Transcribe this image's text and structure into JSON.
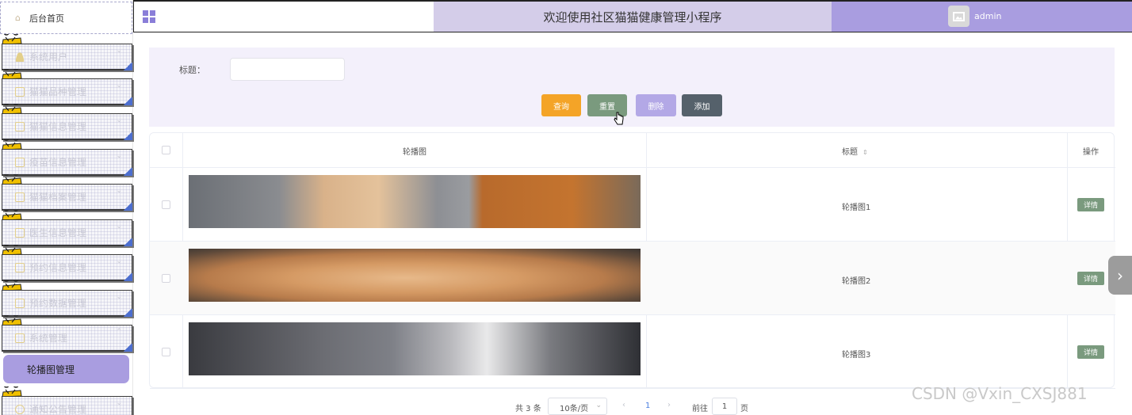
{
  "sidebar": {
    "home_label": "后台首页",
    "items": [
      {
        "label": "系统用户",
        "icon": "person-icon"
      },
      {
        "label": "猫猫品种管理",
        "icon": "folder-icon"
      },
      {
        "label": "猫猫信息管理",
        "icon": "folder-icon"
      },
      {
        "label": "疫苗信息管理",
        "icon": "folder-icon"
      },
      {
        "label": "猫猫档案管理",
        "icon": "folder-icon"
      },
      {
        "label": "医生信息管理",
        "icon": "folder-icon"
      },
      {
        "label": "预约信息管理",
        "icon": "folder-icon"
      },
      {
        "label": "预约数据管理",
        "icon": "folder-icon"
      },
      {
        "label": "系统管理",
        "icon": "image-icon"
      }
    ],
    "active_label": "轮播图管理",
    "after_active": {
      "label": "通知公告管理",
      "icon": "info-icon"
    }
  },
  "header": {
    "title": "欢迎使用社区猫猫健康管理小程序",
    "username": "admin"
  },
  "search": {
    "label": "标题：",
    "value": "",
    "placeholder": "",
    "buttons": {
      "query": "查询",
      "reset": "重置",
      "delete": "删除",
      "add": "添加"
    }
  },
  "table": {
    "columns": {
      "image": "轮播图",
      "title": "标题",
      "actions": "操作"
    },
    "rows": [
      {
        "title": "轮播图1",
        "action": "详情"
      },
      {
        "title": "轮播图2",
        "action": "详情"
      },
      {
        "title": "轮播图3",
        "action": "详情"
      }
    ]
  },
  "pagination": {
    "total": "共 3 条",
    "page_size": "10条/页",
    "prev": "‹",
    "current": "1",
    "next": "›",
    "goto_label": "前往",
    "goto_value": "1",
    "page_suffix": "页"
  },
  "watermark": "CSDN @Vxin_CXSJ881",
  "colors": {
    "accent": "#a99de0",
    "header_title_bg": "#d4cde9",
    "query": "#f4a427",
    "reset": "#7a9a7e",
    "delete": "#b3a8e6",
    "add": "#55616b"
  }
}
